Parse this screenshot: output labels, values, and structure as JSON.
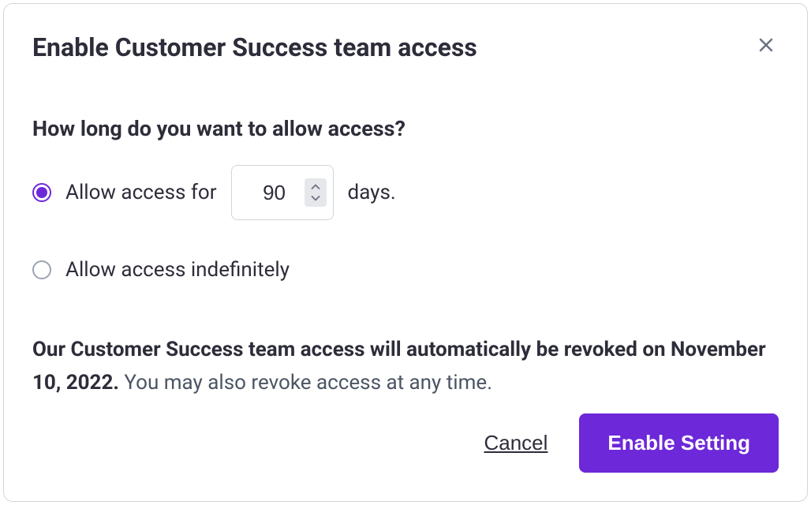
{
  "modal": {
    "title": "Enable Customer Success team access",
    "question": "How long do you want to allow access?",
    "options": {
      "duration": {
        "prefix": "Allow access for",
        "value": "90",
        "suffix": "days.",
        "selected": true
      },
      "indefinite": {
        "label": "Allow access indefinitely",
        "selected": false
      }
    },
    "info": {
      "boldPrefix": "Our Customer Success team access will automatically be revoked on November 10, 2022.",
      "rest": " You may also revoke access at any time."
    },
    "footer": {
      "cancel": "Cancel",
      "enable": "Enable Setting"
    }
  }
}
